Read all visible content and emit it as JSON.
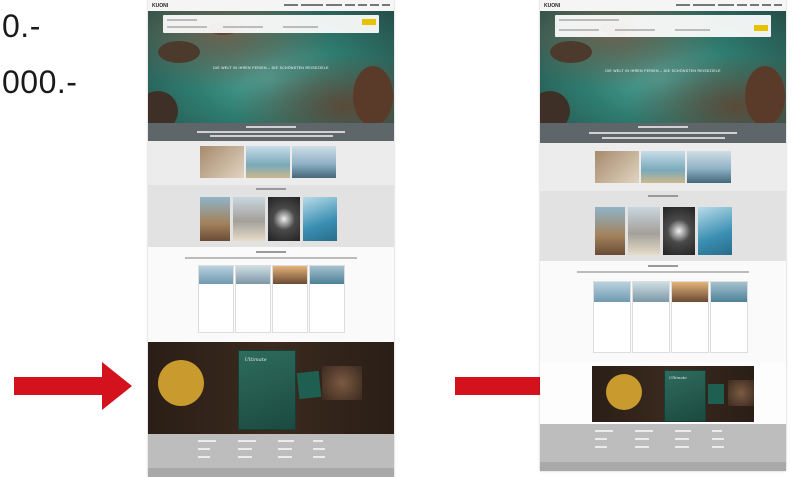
{
  "slide": {
    "line1": "0.-",
    "line2": "000.-"
  },
  "colors": {
    "arrow": "#d3121e",
    "accent": "#e6c200",
    "badge": "#c99a2e"
  },
  "pages": [
    {
      "id": "left-page-thumbnail",
      "logo": "KUONI",
      "tagline": "DIE WELT IN IHREN FERIEN – DIE SCHÖNSTEN REISEZIELE",
      "magazine_title": "Ultimate"
    },
    {
      "id": "right-page-thumbnail",
      "logo": "KUONI",
      "tagline": "DIE WELT IN IHREN FERIEN – DIE SCHÖNSTEN REISEZIELE",
      "magazine_title": "Ultimate"
    }
  ]
}
